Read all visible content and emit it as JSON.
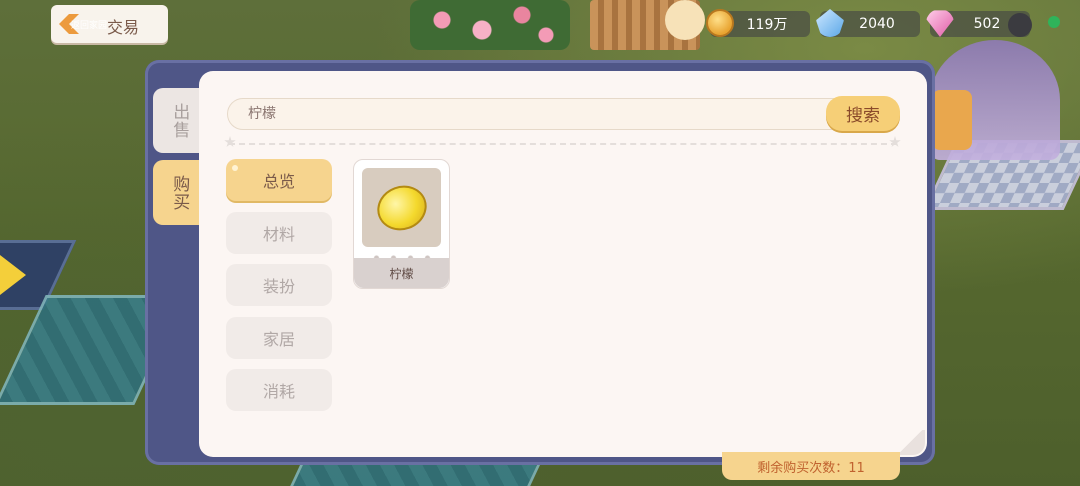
{
  "header": {
    "back_hint": "返回家园",
    "title": "交易"
  },
  "resources": {
    "coins": "119万",
    "crystals": "2040",
    "gems": "502"
  },
  "side_tabs": {
    "sell": "出售",
    "buy": "购买",
    "active": "buy"
  },
  "search": {
    "value": "柠檬",
    "button": "搜索"
  },
  "categories": [
    {
      "label": "总览",
      "active": true
    },
    {
      "label": "材料",
      "active": false
    },
    {
      "label": "装扮",
      "active": false
    },
    {
      "label": "家居",
      "active": false
    },
    {
      "label": "消耗",
      "active": false
    }
  ],
  "items": [
    {
      "name": "柠檬",
      "icon": "lemon-icon"
    }
  ],
  "footer": {
    "remaining": "剩余购买次数：11"
  },
  "colors": {
    "accent": "#f6d48e",
    "panel": "#4f5687",
    "surface": "#fcf6f3"
  }
}
